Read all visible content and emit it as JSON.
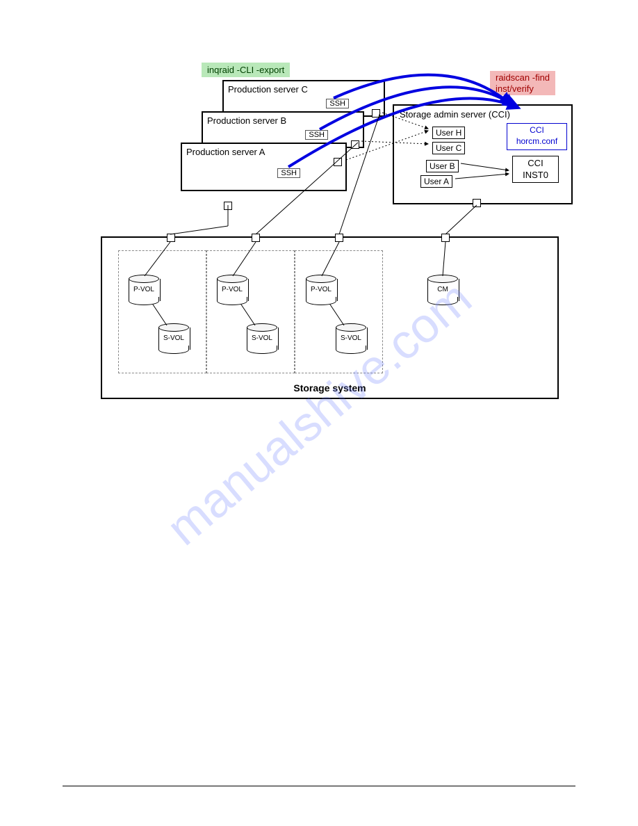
{
  "tags": {
    "inqraid": "inqraid -CLI -export",
    "raidscan": "raidscan -find\ninst/verify"
  },
  "servers": {
    "c": {
      "label": "Production server C",
      "ssh": "SSH"
    },
    "b": {
      "label": "Production server B",
      "ssh": "SSH"
    },
    "a": {
      "label": "Production server A",
      "ssh": "SSH"
    }
  },
  "admin": {
    "title": "Storage admin server (CCI)",
    "users": {
      "h": "User H",
      "c": "User C",
      "b": "User B",
      "a": "User A"
    },
    "cci_conf": "CCI\nhorcm.conf",
    "cci_inst": "CCI\nINST0"
  },
  "storage": {
    "title": "Storage system",
    "pvol": "P-VOL",
    "svol": "S-VOL",
    "cm": "CM"
  },
  "watermark": "manualshive.com"
}
